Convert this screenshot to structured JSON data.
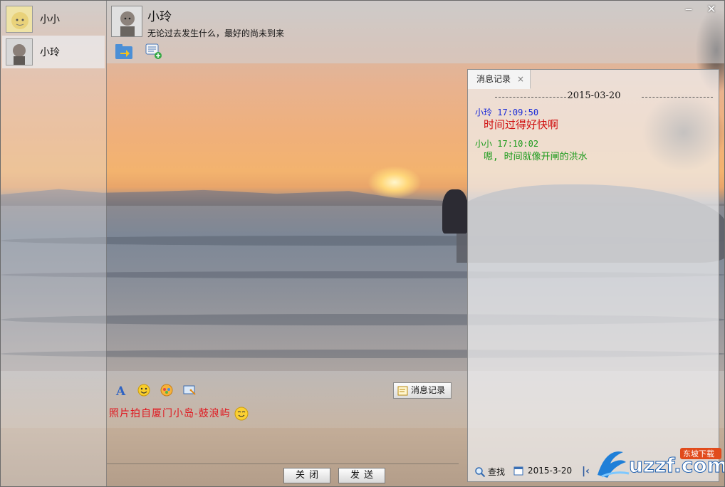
{
  "contacts": [
    {
      "name": "小小",
      "selected": false
    },
    {
      "name": "小玲",
      "selected": true
    }
  ],
  "chat_header": {
    "name": "小玲",
    "signature": "无论过去发生什么，最好的尚未到来"
  },
  "window_controls": {
    "minimize": "‒",
    "close": "✕"
  },
  "history": {
    "tab_label": "消息记录",
    "tab_close": "×",
    "date": "2015-03-20",
    "messages": [
      {
        "sender": "小玲",
        "time": "17:09:50",
        "text": "时间过得好快啊",
        "sender_color": "#1a2bd8",
        "text_color": "#d01010"
      },
      {
        "sender": "小小",
        "time": "17:10:02",
        "text": "嗯, 时间就像开闸的洪水",
        "sender_color": "#1a9a1a",
        "text_color": "#1a9a1a"
      }
    ],
    "search_label": "查找",
    "date_picker_value": "2015-3-20"
  },
  "input": {
    "typed_text": "照片拍自厦门小岛-鼓浪屿",
    "history_button": "消息记录"
  },
  "buttons": {
    "close": "关闭",
    "send": "发送"
  },
  "watermark": {
    "brand": "uzzf.com",
    "tag": "东坡下载"
  },
  "icons": [
    "file-transfer-icon",
    "add-chat-icon",
    "font-icon",
    "emoji-icon",
    "sticker-icon",
    "screenshot-icon",
    "smile-emoji-icon",
    "history-icon",
    "search-icon",
    "calendar-icon",
    "first-page-icon"
  ]
}
